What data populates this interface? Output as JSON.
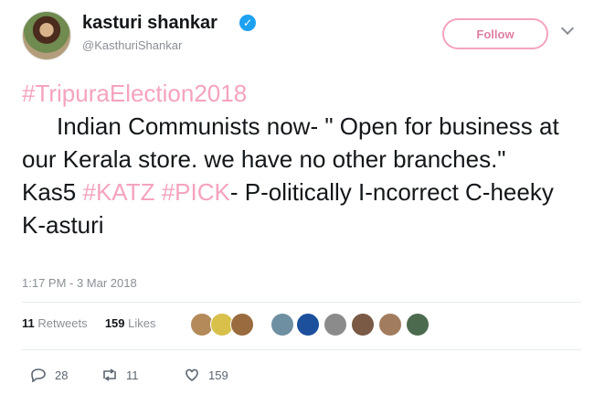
{
  "user": {
    "name": "kasturi shankar",
    "handle": "@KasthuriShankar",
    "verified_icon": "verified-badge-icon",
    "follow_label": "Follow"
  },
  "tweet": {
    "hashtag_1": "#TripuraElection2018",
    "line_1": "Indian Communists now- \" Open for business at our Kerala store. we have no other branches.\"",
    "prefix_2": "Kas5",
    "hashtag_2": "#KATZ",
    "hashtag_3": "#PICK",
    "line_2": "- P-olitically I-ncorrect C-heeky K-asturi",
    "timestamp": "1:17 PM - 3 Mar 2018"
  },
  "stats": {
    "retweets_count": "11",
    "retweets_label": "Retweets",
    "likes_count": "159",
    "likes_label": "Likes"
  },
  "actions": {
    "reply_count": "28",
    "retweet_count": "11",
    "like_count": "159"
  },
  "colors": {
    "hashtag": "#f5a3be",
    "verified": "#1da1f2",
    "muted_text": "#8a8f96"
  }
}
